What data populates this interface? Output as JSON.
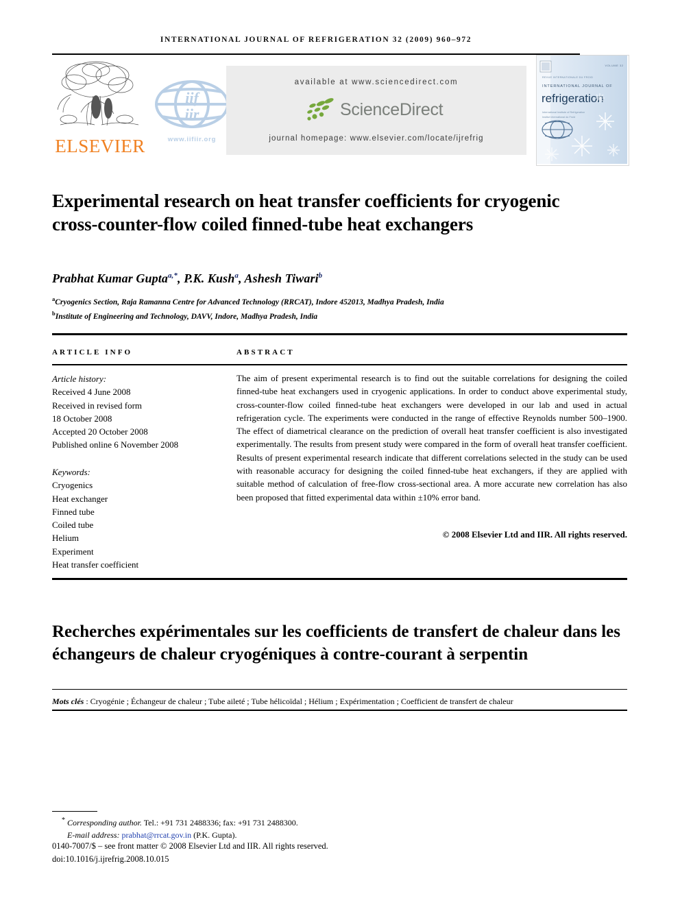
{
  "running_head": "International Journal of Refrigeration 32 (2009) 960–972",
  "masthead": {
    "publisher_name": "ELSEVIER",
    "iif_url": "www.iifiir.org",
    "available_at": "available at www.sciencedirect.com",
    "sciencedirect_wordmark": "ScienceDirect",
    "journal_homepage": "journal homepage: www.elsevier.com/locate/ijrefrig",
    "cover": {
      "volume_label": "VOLUME 32",
      "society_line": "REVUE INTERNATIONALE DU FROID",
      "journal_line": "INTERNATIONAL JOURNAL OF",
      "journal_name": "refrigeration",
      "subtitle_line1": "International Institute of Refrigeration",
      "subtitle_line2": "Institut International du Froid"
    }
  },
  "title": "Experimental research on heat transfer coefficients for cryogenic cross-counter-flow coiled finned-tube heat exchangers",
  "authors": {
    "a1_name": "Prabhat Kumar Gupta",
    "a1_sup": "a,*",
    "a2_name": "P.K. Kush",
    "a2_sup": "a",
    "a3_name": "Ashesh Tiwari",
    "a3_sup": "b",
    "affiliation_a_sup": "a",
    "affiliation_a": "Cryogenics Section, Raja Ramanna Centre for Advanced Technology (RRCAT), Indore 452013, Madhya Pradesh, India",
    "affiliation_b_sup": "b",
    "affiliation_b": "Institute of Engineering and Technology, DAVV, Indore, Madhya Pradesh, India"
  },
  "article_info": {
    "heading": "ARTICLE INFO",
    "history_label": "Article history:",
    "history": [
      "Received 4 June 2008",
      "Received in revised form",
      "18 October 2008",
      "Accepted 20 October 2008",
      "Published online 6 November 2008"
    ],
    "keywords_label": "Keywords:",
    "keywords": [
      "Cryogenics",
      "Heat exchanger",
      "Finned tube",
      "Coiled tube",
      "Helium",
      "Experiment",
      "Heat transfer coefficient"
    ]
  },
  "abstract": {
    "heading": "ABSTRACT",
    "body": "The aim of present experimental research is to find out the suitable correlations for designing the coiled finned-tube heat exchangers used in cryogenic applications. In order to conduct above experimental study, cross-counter-flow coiled finned-tube heat exchangers were developed in our lab and used in actual refrigeration cycle. The experiments were conducted in the range of effective Reynolds number 500–1900. The effect of diametrical clearance on the prediction of overall heat transfer coefficient is also investigated experimentally. The results from present study were compared in the form of overall heat transfer coefficient. Results of present experimental research indicate that different correlations selected in the study can be used with reasonable accuracy for designing the coiled finned-tube heat exchangers, if they are applied with suitable method of calculation of free-flow cross-sectional area. A more accurate new correlation has also been proposed that fitted experimental data within ±10% error band.",
    "copyright": "© 2008 Elsevier Ltd and IIR. All rights reserved."
  },
  "french": {
    "title": "Recherches expérimentales sur les coefficients de transfert de chaleur dans les échangeurs de chaleur cryogéniques à contre-courant à serpentin",
    "keywords_label": "Mots clés",
    "keywords_text": " : Cryogénie ; Échangeur de chaleur ; Tube aileté ; Tube hélicoïdal ; Hélium ; Expérimentation ; Coefficient de transfert de chaleur"
  },
  "footer": {
    "corresponding_label": "Corresponding author.",
    "corresponding_contact": " Tel.: +91 731 2488336; fax: +91 731 2488300.",
    "email_label": "E-mail address:",
    "email": "prabhat@rrcat.gov.in",
    "email_owner": "(P.K. Gupta).",
    "issn_line": "0140-7007/$ – see front matter © 2008 Elsevier Ltd and IIR. All rights reserved.",
    "doi_line": "doi:10.1016/j.ijrefrig.2008.10.015"
  },
  "colors": {
    "elsevier_orange": "#F08122",
    "sciencedirect_grey": "#7a7f7a",
    "sciencedirect_green": "#76a83c",
    "iif_blue": "#b9cfe6",
    "banner_grey": "#ececec",
    "link_blue": "#1f3fae",
    "cover_blue": "#cddcec"
  }
}
